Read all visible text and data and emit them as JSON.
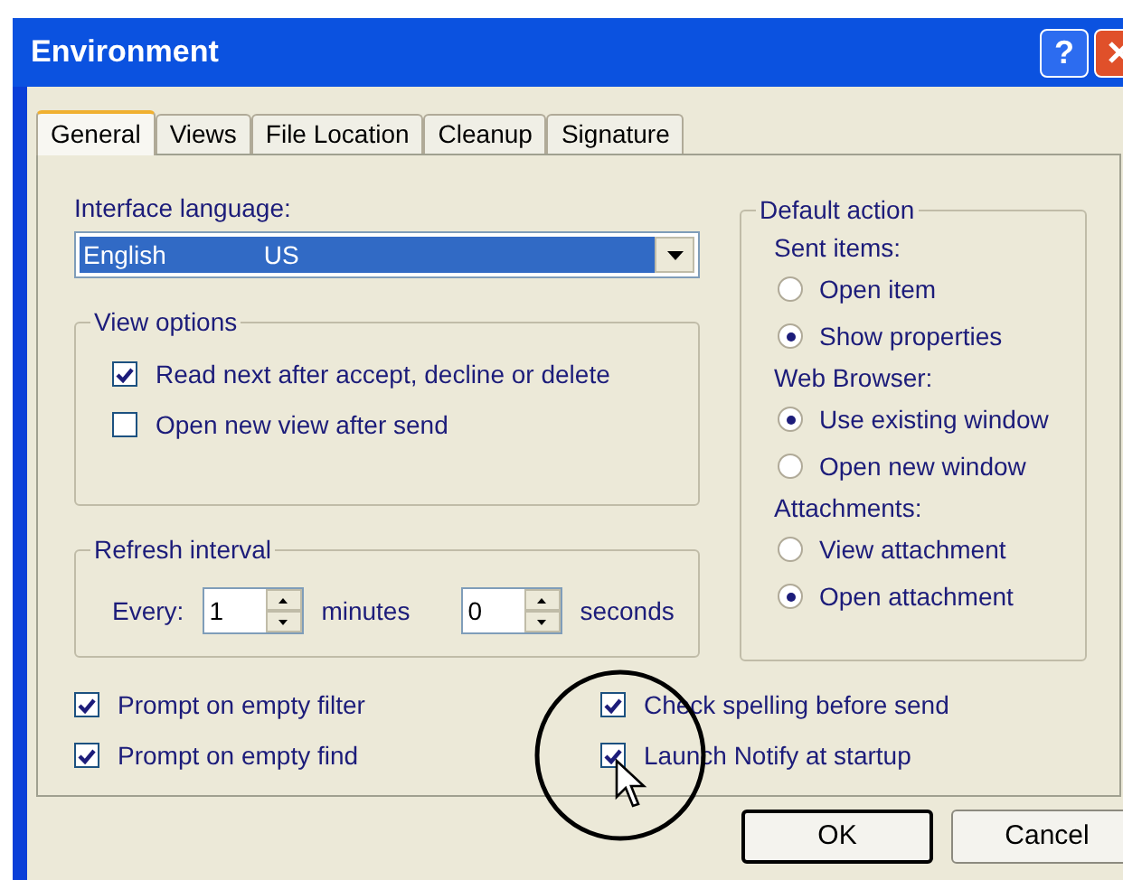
{
  "window": {
    "title": "Environment",
    "help_button": "?"
  },
  "tabs": [
    {
      "label": "General",
      "selected": true
    },
    {
      "label": "Views",
      "selected": false
    },
    {
      "label": "File Location",
      "selected": false
    },
    {
      "label": "Cleanup",
      "selected": false
    },
    {
      "label": "Signature",
      "selected": false
    }
  ],
  "language": {
    "label": "Interface language:",
    "value_parts": [
      "English",
      "US"
    ]
  },
  "view_options": {
    "title": "View options",
    "checkboxes": [
      {
        "label": "Read next after accept, decline or delete",
        "checked": true
      },
      {
        "label": "Open new view after send",
        "checked": false
      }
    ]
  },
  "refresh": {
    "title": "Refresh interval",
    "every_label": "Every:",
    "minutes": {
      "value": "1",
      "unit": "minutes"
    },
    "seconds": {
      "value": "0",
      "unit": "seconds"
    }
  },
  "default_action": {
    "title": "Default action",
    "groups": [
      {
        "label": "Sent items:",
        "options": [
          {
            "label": "Open item",
            "selected": false
          },
          {
            "label": "Show properties",
            "selected": true
          }
        ]
      },
      {
        "label": "Web Browser:",
        "options": [
          {
            "label": "Use existing window",
            "selected": true
          },
          {
            "label": "Open new window",
            "selected": false
          }
        ]
      },
      {
        "label": "Attachments:",
        "options": [
          {
            "label": "View attachment",
            "selected": false
          },
          {
            "label": "Open attachment",
            "selected": true
          }
        ]
      }
    ]
  },
  "bottom_checkboxes": [
    {
      "label": "Prompt on empty filter",
      "checked": true
    },
    {
      "label": "Check spelling before send",
      "checked": true
    },
    {
      "label": "Prompt on empty find",
      "checked": true
    },
    {
      "label": "Launch Notify at startup",
      "checked": true
    }
  ],
  "buttons": [
    {
      "label": "OK",
      "default": true
    },
    {
      "label": "Cancel",
      "default": false
    }
  ]
}
